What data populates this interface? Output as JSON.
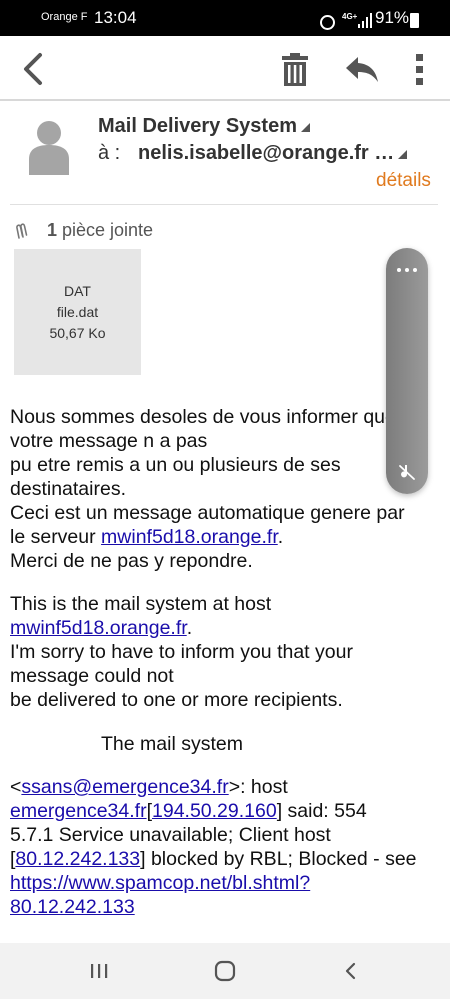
{
  "status_bar": {
    "carrier": "Orange F",
    "time": "13:04",
    "network": "4G+",
    "battery": "91%"
  },
  "toolbar": {
    "back_icon": "arrow-left-icon",
    "delete_icon": "trash-icon",
    "reply_icon": "reply-icon",
    "more_icon": "more-vertical-icon"
  },
  "header": {
    "sender": "Mail Delivery System",
    "to_label": "à :",
    "to_value": "nelis.isabelle@orange.fr …",
    "details_label": "détails"
  },
  "attachments": {
    "count": "1",
    "label": "pièce jointe",
    "file_type": "DAT",
    "file_name": "file.dat",
    "file_size": "50,67 Ko"
  },
  "body": {
    "p1_l1": "Nous sommes desoles de vous informer que",
    "p1_l2": "votre message n a pas",
    "p1_l3": "pu etre remis a un ou plusieurs de ses",
    "p1_l4": "destinataires.",
    "p1_l5": "Ceci est un message automatique genere par",
    "p1_l6_pre": "le serveur ",
    "server_link": "mwinf5d18.orange.fr",
    "p1_l6_post": ".",
    "p1_l7": "Merci de ne pas y repondre.",
    "p2_l1": "This is the mail system at host",
    "p2_l2_post": ".",
    "p2_l3": "I'm sorry to have to inform you that your",
    "p2_l4": "message could not",
    "p2_l5": "be delivered to one or more recipients.",
    "signature": "The mail system",
    "err_open": "<",
    "err_email_link": "ssans@emergence34.fr",
    "err_after_email": ">: host",
    "err_host_link": "emergence34.fr",
    "err_bracket_open": "[",
    "err_ip_link": "194.50.29.160",
    "err_said": "] said: 554",
    "err_line3": "5.7.1 Service unavailable; Client host",
    "err_bracket2_open": "[",
    "err_client_ip_link": "80.12.242.133",
    "err_blocked": "] blocked by RBL; Blocked - see",
    "err_url_link_l1": "https://www.spamcop.net/bl.shtml?",
    "err_url_link_l2": "80.12.242.133"
  },
  "float_panel": {
    "menu_icon": "more-horizontal-icon",
    "mute_icon": "sound-off-icon"
  },
  "nav_bar": {
    "recents_icon": "recents-icon",
    "home_icon": "home-icon",
    "back_icon": "nav-back-icon"
  },
  "colors": {
    "accent": "#e07a1e",
    "link": "#1a0dab",
    "status_bar_bg": "#000000"
  }
}
